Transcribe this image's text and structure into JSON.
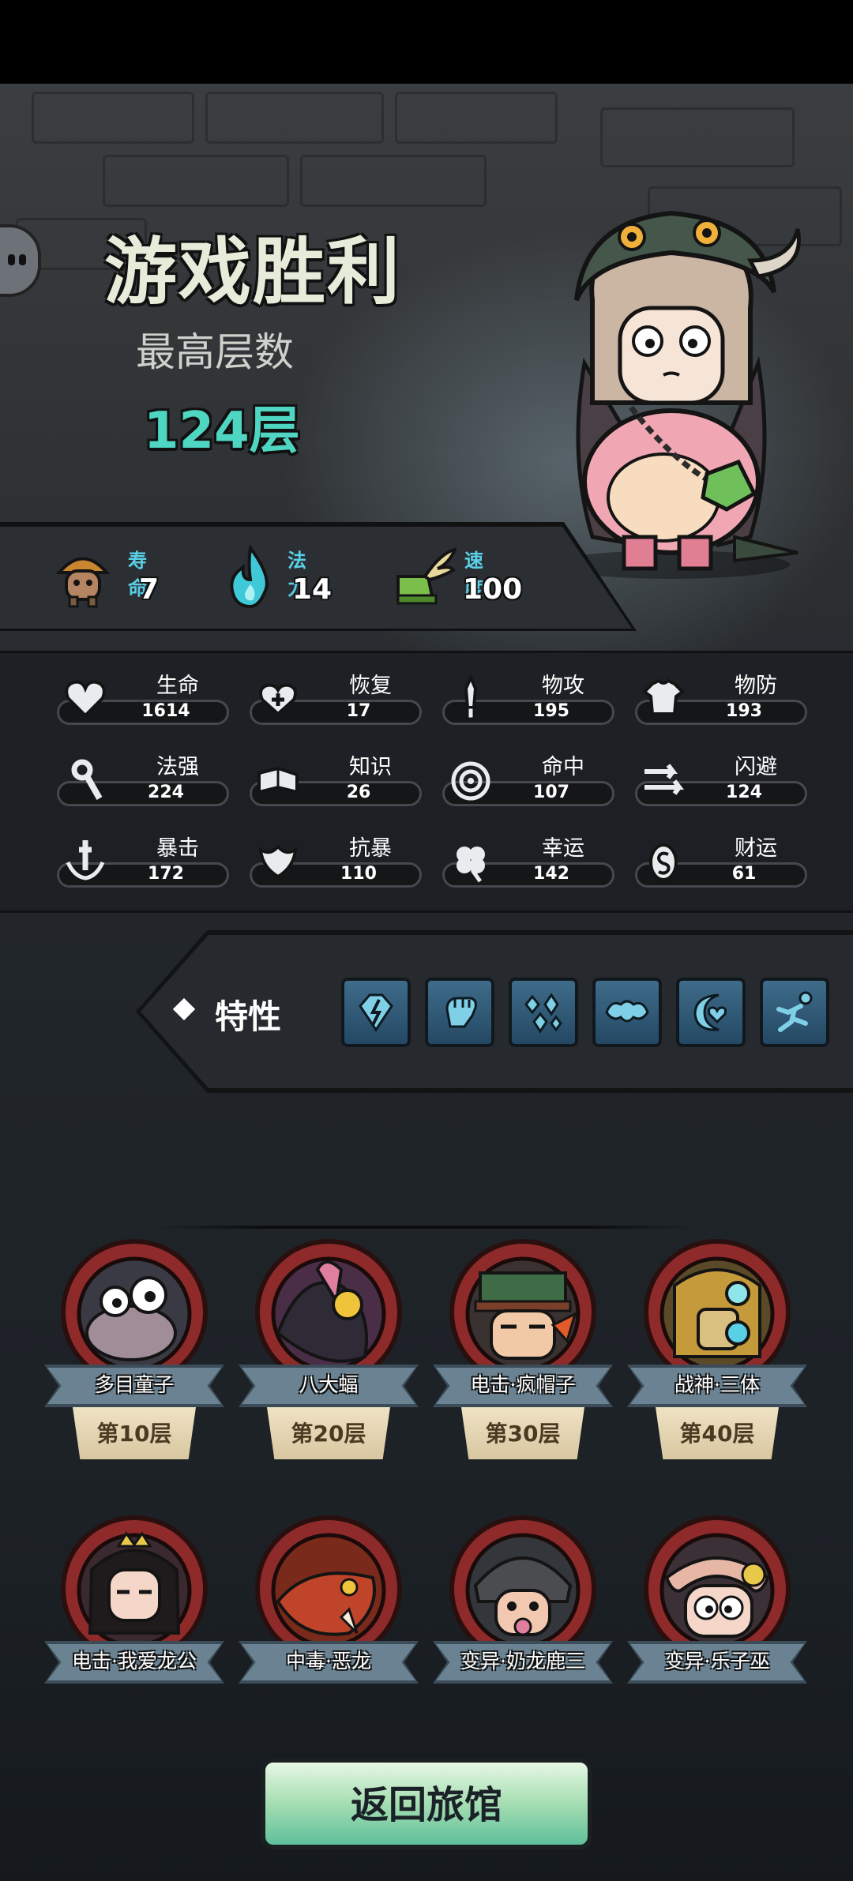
{
  "header": {
    "title": "游戏胜利",
    "floor_label": "最高层数",
    "floor_value": "124层"
  },
  "basic_stats": [
    {
      "label": "寿命",
      "value": "7",
      "icon": "mushroom-character-icon"
    },
    {
      "label": "法力",
      "value": "14",
      "icon": "blue-flame-icon"
    },
    {
      "label": "速度",
      "value": "100",
      "icon": "winged-boot-icon"
    }
  ],
  "attributes": [
    {
      "name": "生命",
      "value": "1614",
      "icon": "heart-icon"
    },
    {
      "name": "恢复",
      "value": "17",
      "icon": "heal-heart-icon"
    },
    {
      "name": "物攻",
      "value": "195",
      "icon": "sword-icon"
    },
    {
      "name": "物防",
      "value": "193",
      "icon": "armor-icon"
    },
    {
      "name": "法强",
      "value": "224",
      "icon": "staff-icon"
    },
    {
      "name": "知识",
      "value": "26",
      "icon": "book-icon"
    },
    {
      "name": "命中",
      "value": "107",
      "icon": "target-icon"
    },
    {
      "name": "闪避",
      "value": "124",
      "icon": "dodge-arrows-icon"
    },
    {
      "name": "暴击",
      "value": "172",
      "icon": "critical-sword-icon"
    },
    {
      "name": "抗暴",
      "value": "110",
      "icon": "shield-wing-icon"
    },
    {
      "name": "幸运",
      "value": "142",
      "icon": "clover-icon"
    },
    {
      "name": "财运",
      "value": "61",
      "icon": "coin-icon"
    }
  ],
  "traits": {
    "label": "特性",
    "items": [
      "gem-lightning-icon",
      "fist-icon",
      "crystals-icon",
      "muscle-icon",
      "moon-heart-icon",
      "leaping-figure-icon"
    ]
  },
  "bosses": [
    {
      "name": "多目童子",
      "floor": "第10层"
    },
    {
      "name": "八大蝠",
      "floor": "第20层"
    },
    {
      "name": "电击·疯帽子",
      "floor": "第30层"
    },
    {
      "name": "战神·三体",
      "floor": "第40层"
    },
    {
      "name": "电击·我爱龙公",
      "floor": ""
    },
    {
      "name": "中毒·恶龙",
      "floor": ""
    },
    {
      "name": "变异·奶龙鹿三",
      "floor": ""
    },
    {
      "name": "变异·乐子巫",
      "floor": ""
    }
  ],
  "footer": {
    "return_label": "返回旅馆"
  },
  "colors": {
    "accent_teal": "#4fd6c3",
    "stat_label_blue": "#5ad0e6",
    "trait_blue": "#3e6c8a",
    "boss_frame_red": "#8e2a2a",
    "button_green": "#a6deb2"
  }
}
